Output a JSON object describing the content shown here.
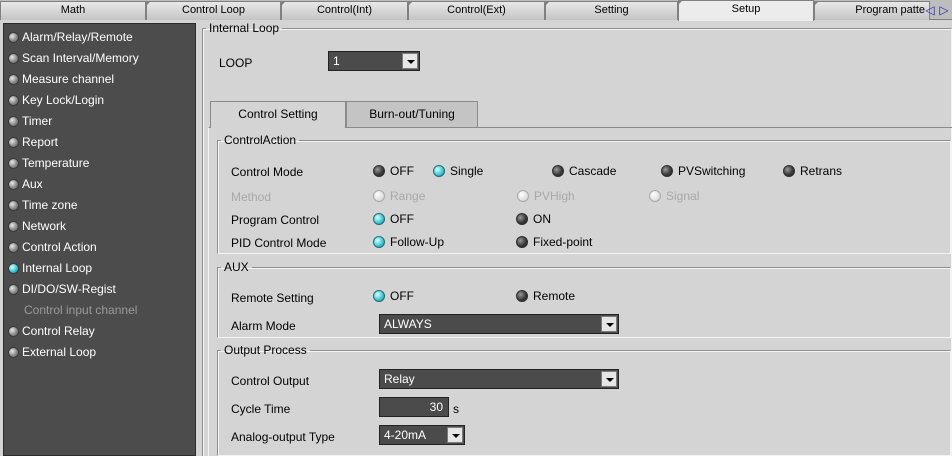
{
  "tabs": [
    {
      "label": "Math"
    },
    {
      "label": "Control Loop"
    },
    {
      "label": "Control(Int)"
    },
    {
      "label": "Control(Ext)"
    },
    {
      "label": "Setting"
    },
    {
      "label": "Setup"
    },
    {
      "label": "Program patte"
    }
  ],
  "active_tab": "Setup",
  "nav_arrows": {
    "left": "◁",
    "right": "▷"
  },
  "sidebar": {
    "items": [
      {
        "label": "Alarm/Relay/Remote"
      },
      {
        "label": "Scan Interval/Memory"
      },
      {
        "label": "Measure channel"
      },
      {
        "label": "Key Lock/Login"
      },
      {
        "label": "Timer"
      },
      {
        "label": "Report"
      },
      {
        "label": "Temperature"
      },
      {
        "label": "Aux"
      },
      {
        "label": "Time zone"
      },
      {
        "label": "Network"
      },
      {
        "label": "Control Action"
      },
      {
        "label": "Internal Loop"
      },
      {
        "label": "DI/DO/SW-Regist"
      },
      {
        "label": "Control input channel"
      },
      {
        "label": "Control Relay"
      },
      {
        "label": "External Loop"
      }
    ],
    "selected": "Internal Loop"
  },
  "internal_loop": {
    "title": "Internal Loop",
    "loop_label": "LOOP",
    "loop_value": "1",
    "subtabs": [
      {
        "label": "Control Setting"
      },
      {
        "label": "Burn-out/Tuning"
      }
    ]
  },
  "control_action": {
    "title": "ControlAction",
    "control_mode": {
      "label": "Control Mode",
      "options": [
        "OFF",
        "Single",
        "Cascade",
        "PVSwitching",
        "Retrans"
      ],
      "selected": "Single"
    },
    "method": {
      "label": "Method",
      "options": [
        "Range",
        "PVHigh",
        "Signal"
      ]
    },
    "program_control": {
      "label": "Program Control",
      "options": [
        "OFF",
        "ON"
      ],
      "selected": "OFF"
    },
    "pid_control_mode": {
      "label": "PID Control Mode",
      "options": [
        "Follow-Up",
        "Fixed-point"
      ],
      "selected": "Follow-Up"
    }
  },
  "aux": {
    "title": "AUX",
    "remote_setting": {
      "label": "Remote Setting",
      "options": [
        "OFF",
        "Remote"
      ],
      "selected": "OFF"
    },
    "alarm_mode": {
      "label": "Alarm Mode",
      "value": "ALWAYS"
    }
  },
  "output_process": {
    "title": "Output Process",
    "control_output": {
      "label": "Control Output",
      "value": "Relay"
    },
    "cycle_time": {
      "label": "Cycle Time",
      "value": "30",
      "unit": "s"
    },
    "analog_output_type": {
      "label": "Analog-output Type",
      "value": "4-20mA"
    }
  },
  "colors": {
    "sidebar_bg": "#4c4c4c",
    "led_on": "#3ac6d8",
    "field_bg": "#4b4b4b"
  }
}
